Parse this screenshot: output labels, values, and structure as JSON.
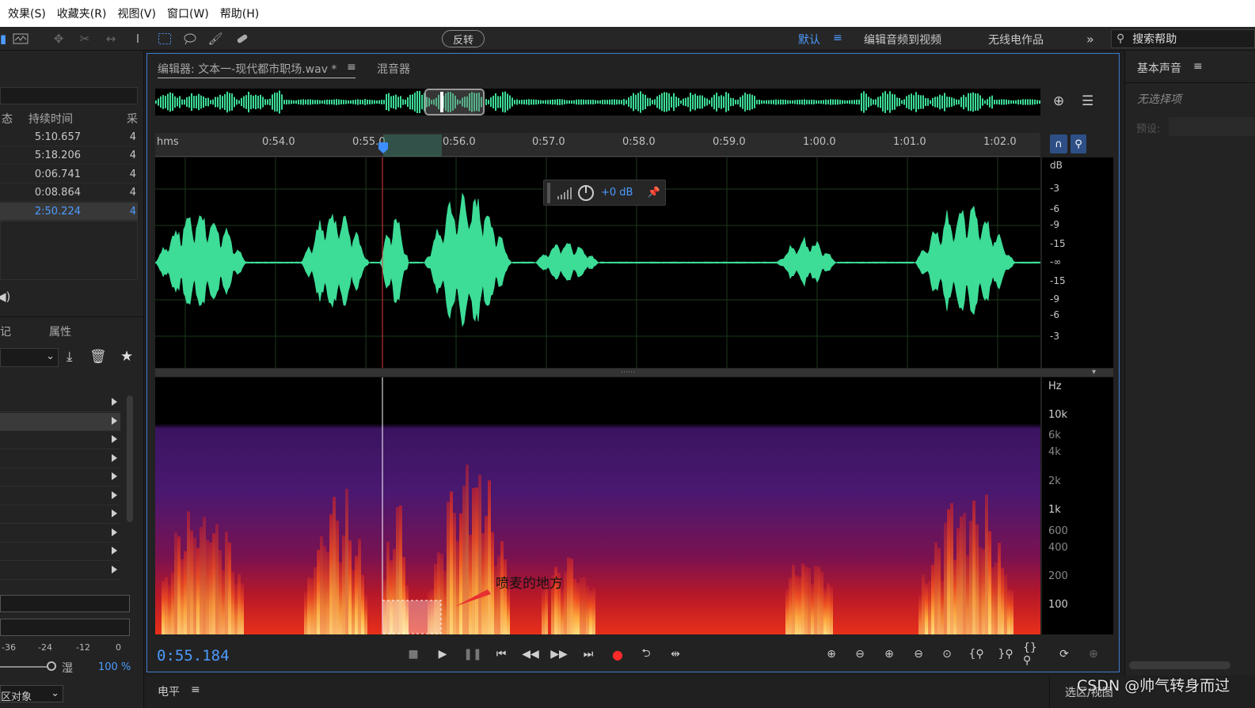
{
  "menu": [
    "效果(S)",
    "收藏夹(R)",
    "视图(V)",
    "窗口(W)",
    "帮助(H)"
  ],
  "toolbar": {
    "reverse_label": "反转",
    "workspaces": [
      "默认",
      "编辑音频到视频",
      "无线电作品"
    ],
    "more_glyph": "»",
    "search_placeholder": "搜索帮助"
  },
  "files_panel": {
    "col_status": "态",
    "col_duration": "持续时间",
    "col_rate": "采",
    "rows": [
      {
        "duration": "5:10.657",
        "ch": "4"
      },
      {
        "duration": "5:18.206",
        "ch": "4"
      },
      {
        "duration": "0:06.741",
        "ch": "4"
      },
      {
        "duration": "0:08.864",
        "ch": "4"
      },
      {
        "duration": "2:50.224",
        "ch": "4"
      }
    ]
  },
  "props_panel": {
    "tab_markers": "记",
    "tab_props": "属性",
    "meter_labels": [
      "-36",
      "-24",
      "-12",
      "0"
    ],
    "wet_label": "湿",
    "wet_value": "100 %",
    "region_label": "区对象"
  },
  "editor": {
    "tab_editor": "编辑器: 文本一-现代都市职场.wav *",
    "tab_mixer": "混音器",
    "ruler_unit": "hms",
    "ticks": [
      "0:54.0",
      "0:55.0",
      "0:56.0",
      "0:57.0",
      "0:58.0",
      "0:59.0",
      "1:00.0",
      "1:01.0",
      "1:02.0"
    ],
    "db_unit": "dB",
    "db_labels": [
      "-3",
      "-6",
      "-9",
      "-15",
      "-∞",
      "-15",
      "-9",
      "-6",
      "-3"
    ],
    "hz_unit": "Hz",
    "hz_labels": [
      "10k",
      "6k",
      "4k",
      "2k",
      "1k",
      "600",
      "400",
      "200",
      "100"
    ],
    "hud_gain": "+0 dB",
    "annotation": "喷麦的地方",
    "timecode": "0:55.184"
  },
  "right_panel": {
    "title": "基本声音",
    "no_selection": "无选择项",
    "preset_label": "预设:"
  },
  "bottom": {
    "level_label": "电平",
    "selection_view": "选区/视图"
  },
  "watermark": "CSDN @帅气转身而过",
  "colors": {
    "accent": "#4d9bff",
    "wave": "#3ddc97",
    "playhead": "#e23a3a"
  }
}
